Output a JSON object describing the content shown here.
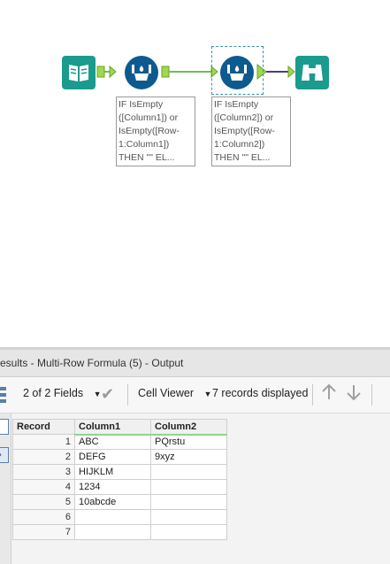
{
  "workflow": {
    "annotations": [
      [
        "IF IsEmpty",
        "([Column1]) or",
        "IsEmpty([Row-",
        "1:Column1])",
        "THEN \"\" EL..."
      ],
      [
        "IF IsEmpty",
        "([Column2]) or",
        "IsEmpty([Row-",
        "1:Column2])",
        "THEN \"\" EL..."
      ]
    ]
  },
  "results": {
    "title": "esults - Multi-Row Formula (5) - Output",
    "fields_label": "2 of 2 Fields",
    "viewer_label": "Cell Viewer",
    "records_label": "7 records displayed",
    "columns": [
      "Record",
      "Column1",
      "Column2"
    ],
    "rows": [
      [
        "1",
        "ABC",
        "PQrstu"
      ],
      [
        "2",
        "DEFG",
        "9xyz"
      ],
      [
        "3",
        "HIJKLM",
        ""
      ],
      [
        "4",
        "1234",
        ""
      ],
      [
        "5",
        "10abcde",
        ""
      ],
      [
        "6",
        "",
        ""
      ],
      [
        "7",
        "",
        ""
      ]
    ]
  },
  "colors": {
    "input_tool": "#1a9b8d",
    "multirow_tool": "#0d5a8f",
    "browse_tool": "#1a9b8d",
    "connector": "#6dbf5a",
    "connector_alt": "#4a3a8a",
    "column_header_underline": "#8fd48f"
  },
  "icons": {
    "input": "book-icon",
    "multirow": "flask-icon",
    "browse": "binoculars-icon",
    "check": "check-icon",
    "up": "arrow-up-icon",
    "down": "arrow-down-icon"
  }
}
